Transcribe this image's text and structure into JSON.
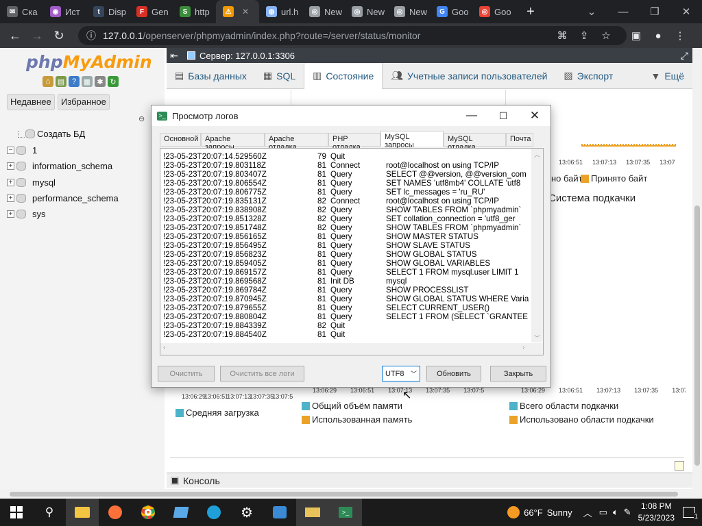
{
  "browser": {
    "tabs": [
      {
        "label": "Ска",
        "icon": "mail-icon",
        "color": "#5f6368"
      },
      {
        "label": "Ист",
        "icon": "podcast-icon",
        "color": "#a05cc7"
      },
      {
        "label": "Disp",
        "icon": "tumblr-icon",
        "color": "#35465c"
      },
      {
        "label": "Gen",
        "icon": "f-logo-icon",
        "color": "#d93025"
      },
      {
        "label": "http",
        "icon": "s-logo-icon",
        "color": "#3c8c3c"
      },
      {
        "label": "",
        "icon": "warning-icon",
        "color": "#f29900",
        "active": true
      },
      {
        "label": "url.h",
        "icon": "globe-icon",
        "color": "#8ab4f8"
      },
      {
        "label": "New",
        "icon": "chrome-icon",
        "color": "#9aa0a6"
      },
      {
        "label": "New",
        "icon": "chrome-icon",
        "color": "#9aa0a6"
      },
      {
        "label": "New",
        "icon": "chrome-icon",
        "color": "#9aa0a6"
      },
      {
        "label": "Goo",
        "icon": "google-icon",
        "color": "#4285f4"
      },
      {
        "label": "Goo",
        "icon": "chrome-icon",
        "color": "#ea4335"
      }
    ],
    "url_host": "127.0.0.1",
    "url_path": "/openserver/phpmyadmin/index.php?route=/server/status/monitor"
  },
  "sidebar": {
    "logo_php": "php",
    "logo_myadmin": "MyAdmin",
    "tab_recent": "Недавнее",
    "tab_favorites": "Избранное",
    "create_db": "Создать БД",
    "databases": [
      "1",
      "information_schema",
      "mysql",
      "performance_schema",
      "sys"
    ]
  },
  "main": {
    "server_label": "Сервер: 127.0.0.1:3306",
    "tabs": [
      {
        "label": "Базы данных",
        "icon": "database-icon"
      },
      {
        "label": "SQL",
        "icon": "sql-icon"
      },
      {
        "label": "Состояние",
        "icon": "status-icon",
        "active": true
      },
      {
        "label": "Учетные записи пользователей",
        "icon": "users-icon"
      },
      {
        "label": "Экспорт",
        "icon": "export-icon"
      },
      {
        "label": "Ещё",
        "icon": "chevron-down-icon"
      }
    ],
    "top_times": [
      "13:06:51",
      "13:07:13",
      "13:07:35",
      "13:07"
    ],
    "legend_sent_partial": "но байт",
    "legend_received": "Принято байт",
    "swap_title": "Система подкачки",
    "bottom_times_left": [
      "13:06:29",
      "13:06:51",
      "13:07:13",
      "13:07:35",
      "13:07:5"
    ],
    "bottom_times_mid": [
      "13:06:29",
      "13:06:51",
      "13:07:13",
      "13:07:35",
      "13:07:5"
    ],
    "bottom_times_right": [
      "13:06:29",
      "13:06:51",
      "13:07:13",
      "13:07:35",
      "13:07"
    ],
    "legend_avg_load": "Средняя загрузка",
    "legend_total_mem": "Общий объём памяти",
    "legend_used_mem": "Использованная память",
    "legend_total_swap": "Всего области подкачки",
    "legend_used_swap": "Использовано области подкачки",
    "console_label": "Консоль",
    "colors": {
      "teal": "#4db3c9",
      "orange": "#eaa228"
    }
  },
  "dialog": {
    "title": "Просмотр логов",
    "tabs": [
      "Основной",
      "Apache запросы",
      "Apache отладка",
      "PHP отладка",
      "MySQL запросы",
      "MySQL отладка",
      "Почта"
    ],
    "active_tab": "MySQL запросы",
    "log_lines": [
      {
        "time": "!23-05-23T20:07:14.529560Z",
        "id": "79",
        "cmd": "Quit",
        "arg": ""
      },
      {
        "time": "!23-05-23T20:07:19.803118Z",
        "id": "81",
        "cmd": "Connect",
        "arg": "root@localhost on  using TCP/IP"
      },
      {
        "time": "!23-05-23T20:07:19.803407Z",
        "id": "81",
        "cmd": "Query",
        "arg": "SELECT @@version, @@version_com"
      },
      {
        "time": "!23-05-23T20:07:19.806554Z",
        "id": "81",
        "cmd": "Query",
        "arg": "SET NAMES 'utf8mb4' COLLATE 'utf8"
      },
      {
        "time": "!23-05-23T20:07:19.806775Z",
        "id": "81",
        "cmd": "Query",
        "arg": "SET lc_messages = 'ru_RU'"
      },
      {
        "time": "!23-05-23T20:07:19.835131Z",
        "id": "82",
        "cmd": "Connect",
        "arg": "root@localhost on  using TCP/IP"
      },
      {
        "time": "!23-05-23T20:07:19.838908Z",
        "id": "82",
        "cmd": "Query",
        "arg": "SHOW TABLES FROM `phpmyadmin`"
      },
      {
        "time": "!23-05-23T20:07:19.851328Z",
        "id": "82",
        "cmd": "Query",
        "arg": "SET collation_connection = 'utf8_ger"
      },
      {
        "time": "!23-05-23T20:07:19.851748Z",
        "id": "82",
        "cmd": "Query",
        "arg": "SHOW TABLES FROM `phpmyadmin`"
      },
      {
        "time": "!23-05-23T20:07:19.856165Z",
        "id": "81",
        "cmd": "Query",
        "arg": "SHOW MASTER STATUS"
      },
      {
        "time": "!23-05-23T20:07:19.856495Z",
        "id": "81",
        "cmd": "Query",
        "arg": "SHOW SLAVE STATUS"
      },
      {
        "time": "!23-05-23T20:07:19.856823Z",
        "id": "81",
        "cmd": "Query",
        "arg": "SHOW GLOBAL STATUS"
      },
      {
        "time": "!23-05-23T20:07:19.859405Z",
        "id": "81",
        "cmd": "Query",
        "arg": "SHOW GLOBAL VARIABLES"
      },
      {
        "time": "!23-05-23T20:07:19.869157Z",
        "id": "81",
        "cmd": "Query",
        "arg": "SELECT 1 FROM mysql.user LIMIT 1"
      },
      {
        "time": "!23-05-23T20:07:19.869568Z",
        "id": "81",
        "cmd": "Init DB",
        "arg": "mysql"
      },
      {
        "time": "!23-05-23T20:07:19.869784Z",
        "id": "81",
        "cmd": "Query",
        "arg": "SHOW PROCESSLIST"
      },
      {
        "time": "!23-05-23T20:07:19.870945Z",
        "id": "81",
        "cmd": "Query",
        "arg": "SHOW GLOBAL STATUS WHERE Varia"
      },
      {
        "time": "!23-05-23T20:07:19.879655Z",
        "id": "81",
        "cmd": "Query",
        "arg": "SELECT CURRENT_USER()"
      },
      {
        "time": "!23-05-23T20:07:19.880804Z",
        "id": "81",
        "cmd": "Query",
        "arg": "SELECT 1 FROM (SELECT `GRANTEE"
      },
      {
        "time": "!23-05-23T20:07:19.884339Z",
        "id": "82",
        "cmd": "Quit",
        "arg": ""
      },
      {
        "time": "!23-05-23T20:07:19.884540Z",
        "id": "81",
        "cmd": "Quit",
        "arg": ""
      }
    ],
    "btn_clear": "Очистить",
    "btn_clear_all": "Очистить все логи",
    "encoding": "UTF8",
    "btn_refresh": "Обновить",
    "btn_close": "Закрыть"
  },
  "taskbar": {
    "weather_temp": "66°F",
    "weather_text": "Sunny",
    "time": "1:08 PM",
    "date": "5/23/2023",
    "notifications": "1"
  }
}
